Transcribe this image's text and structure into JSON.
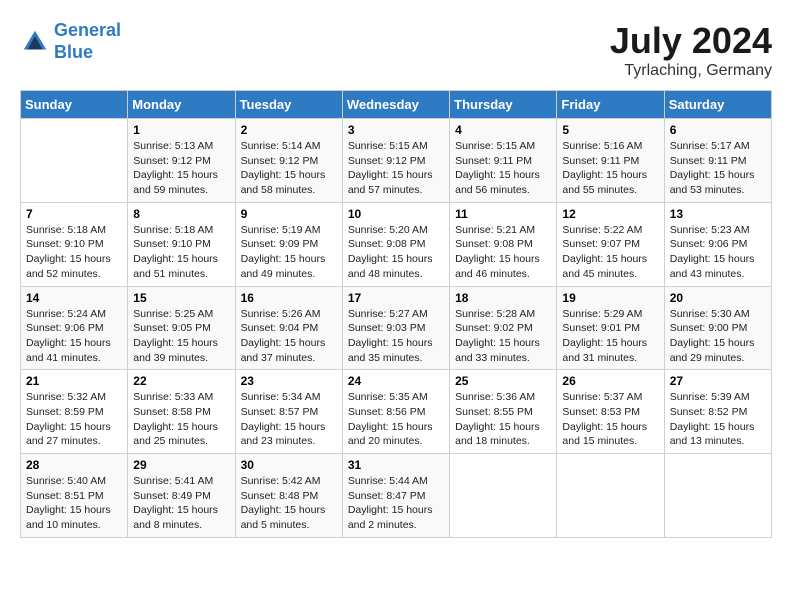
{
  "header": {
    "logo_line1": "General",
    "logo_line2": "Blue",
    "month": "July 2024",
    "location": "Tyrlaching, Germany"
  },
  "weekdays": [
    "Sunday",
    "Monday",
    "Tuesday",
    "Wednesday",
    "Thursday",
    "Friday",
    "Saturday"
  ],
  "weeks": [
    [
      {
        "day": "",
        "info": ""
      },
      {
        "day": "1",
        "info": "Sunrise: 5:13 AM\nSunset: 9:12 PM\nDaylight: 15 hours\nand 59 minutes."
      },
      {
        "day": "2",
        "info": "Sunrise: 5:14 AM\nSunset: 9:12 PM\nDaylight: 15 hours\nand 58 minutes."
      },
      {
        "day": "3",
        "info": "Sunrise: 5:15 AM\nSunset: 9:12 PM\nDaylight: 15 hours\nand 57 minutes."
      },
      {
        "day": "4",
        "info": "Sunrise: 5:15 AM\nSunset: 9:11 PM\nDaylight: 15 hours\nand 56 minutes."
      },
      {
        "day": "5",
        "info": "Sunrise: 5:16 AM\nSunset: 9:11 PM\nDaylight: 15 hours\nand 55 minutes."
      },
      {
        "day": "6",
        "info": "Sunrise: 5:17 AM\nSunset: 9:11 PM\nDaylight: 15 hours\nand 53 minutes."
      }
    ],
    [
      {
        "day": "7",
        "info": "Sunrise: 5:18 AM\nSunset: 9:10 PM\nDaylight: 15 hours\nand 52 minutes."
      },
      {
        "day": "8",
        "info": "Sunrise: 5:18 AM\nSunset: 9:10 PM\nDaylight: 15 hours\nand 51 minutes."
      },
      {
        "day": "9",
        "info": "Sunrise: 5:19 AM\nSunset: 9:09 PM\nDaylight: 15 hours\nand 49 minutes."
      },
      {
        "day": "10",
        "info": "Sunrise: 5:20 AM\nSunset: 9:08 PM\nDaylight: 15 hours\nand 48 minutes."
      },
      {
        "day": "11",
        "info": "Sunrise: 5:21 AM\nSunset: 9:08 PM\nDaylight: 15 hours\nand 46 minutes."
      },
      {
        "day": "12",
        "info": "Sunrise: 5:22 AM\nSunset: 9:07 PM\nDaylight: 15 hours\nand 45 minutes."
      },
      {
        "day": "13",
        "info": "Sunrise: 5:23 AM\nSunset: 9:06 PM\nDaylight: 15 hours\nand 43 minutes."
      }
    ],
    [
      {
        "day": "14",
        "info": "Sunrise: 5:24 AM\nSunset: 9:06 PM\nDaylight: 15 hours\nand 41 minutes."
      },
      {
        "day": "15",
        "info": "Sunrise: 5:25 AM\nSunset: 9:05 PM\nDaylight: 15 hours\nand 39 minutes."
      },
      {
        "day": "16",
        "info": "Sunrise: 5:26 AM\nSunset: 9:04 PM\nDaylight: 15 hours\nand 37 minutes."
      },
      {
        "day": "17",
        "info": "Sunrise: 5:27 AM\nSunset: 9:03 PM\nDaylight: 15 hours\nand 35 minutes."
      },
      {
        "day": "18",
        "info": "Sunrise: 5:28 AM\nSunset: 9:02 PM\nDaylight: 15 hours\nand 33 minutes."
      },
      {
        "day": "19",
        "info": "Sunrise: 5:29 AM\nSunset: 9:01 PM\nDaylight: 15 hours\nand 31 minutes."
      },
      {
        "day": "20",
        "info": "Sunrise: 5:30 AM\nSunset: 9:00 PM\nDaylight: 15 hours\nand 29 minutes."
      }
    ],
    [
      {
        "day": "21",
        "info": "Sunrise: 5:32 AM\nSunset: 8:59 PM\nDaylight: 15 hours\nand 27 minutes."
      },
      {
        "day": "22",
        "info": "Sunrise: 5:33 AM\nSunset: 8:58 PM\nDaylight: 15 hours\nand 25 minutes."
      },
      {
        "day": "23",
        "info": "Sunrise: 5:34 AM\nSunset: 8:57 PM\nDaylight: 15 hours\nand 23 minutes."
      },
      {
        "day": "24",
        "info": "Sunrise: 5:35 AM\nSunset: 8:56 PM\nDaylight: 15 hours\nand 20 minutes."
      },
      {
        "day": "25",
        "info": "Sunrise: 5:36 AM\nSunset: 8:55 PM\nDaylight: 15 hours\nand 18 minutes."
      },
      {
        "day": "26",
        "info": "Sunrise: 5:37 AM\nSunset: 8:53 PM\nDaylight: 15 hours\nand 15 minutes."
      },
      {
        "day": "27",
        "info": "Sunrise: 5:39 AM\nSunset: 8:52 PM\nDaylight: 15 hours\nand 13 minutes."
      }
    ],
    [
      {
        "day": "28",
        "info": "Sunrise: 5:40 AM\nSunset: 8:51 PM\nDaylight: 15 hours\nand 10 minutes."
      },
      {
        "day": "29",
        "info": "Sunrise: 5:41 AM\nSunset: 8:49 PM\nDaylight: 15 hours\nand 8 minutes."
      },
      {
        "day": "30",
        "info": "Sunrise: 5:42 AM\nSunset: 8:48 PM\nDaylight: 15 hours\nand 5 minutes."
      },
      {
        "day": "31",
        "info": "Sunrise: 5:44 AM\nSunset: 8:47 PM\nDaylight: 15 hours\nand 2 minutes."
      },
      {
        "day": "",
        "info": ""
      },
      {
        "day": "",
        "info": ""
      },
      {
        "day": "",
        "info": ""
      }
    ]
  ]
}
